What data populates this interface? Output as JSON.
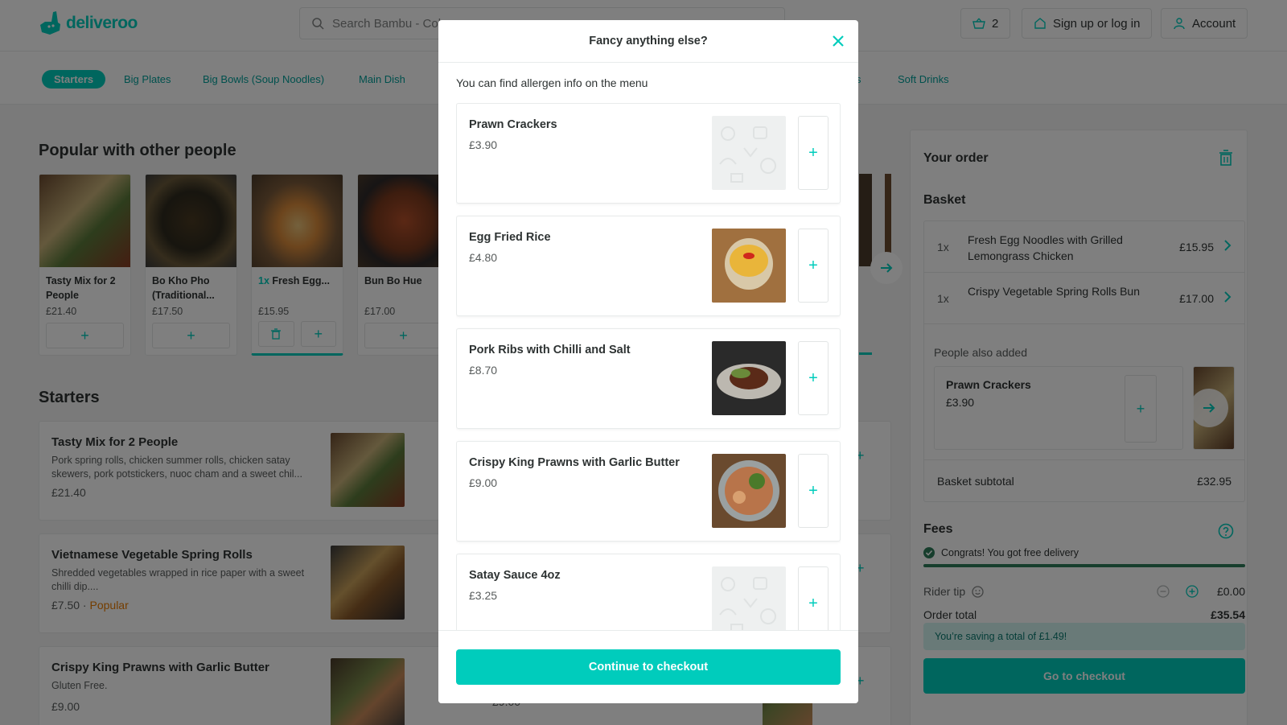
{
  "header": {
    "logo_text": "deliveroo",
    "search_placeholder": "Search Bambu - Col",
    "basket_count": "2",
    "signup_label": "Sign up or log in",
    "account_label": "Account"
  },
  "categories": [
    {
      "label": "Starters",
      "active": true
    },
    {
      "label": "Big Plates",
      "active": false
    },
    {
      "label": "Big Bowls (Soup Noodles)",
      "active": false
    },
    {
      "label": "Main Dish",
      "active": false
    },
    {
      "label": "s",
      "active": false
    },
    {
      "label": "Soft Drinks",
      "active": false
    }
  ],
  "popular": {
    "title": "Popular with other people",
    "items": [
      {
        "name": "Tasty Mix for 2 People",
        "price": "£21.40"
      },
      {
        "name": "Bo Kho Pho (Traditional...",
        "price": "£17.50"
      },
      {
        "qty": "1x",
        "name": "Fresh Egg...",
        "price": "£15.95"
      },
      {
        "name": "Bun Bo Hue",
        "price": "£17.00"
      }
    ]
  },
  "starters": {
    "title": "Starters",
    "items": [
      {
        "name": "Tasty Mix for 2 People",
        "desc": "Pork spring rolls, chicken summer rolls, chicken satay skewers, pork potstickers, nuoc cham and a sweet chil...",
        "price": "£21.40",
        "tag": ""
      },
      {
        "name": "Vietnamese Vegetable Spring Rolls",
        "desc": "Shredded vegetables wrapped in rice paper with a sweet chilli dip....",
        "price": "£7.50",
        "sep": " · ",
        "tag": "Popular"
      },
      {
        "name": "Crispy King Prawns with Garlic Butter",
        "desc": "Gluten Free.",
        "price": "£9.00",
        "tag": ""
      }
    ],
    "peek_price": "£9.00"
  },
  "order": {
    "title": "Your order",
    "basket_title": "Basket",
    "items": [
      {
        "qty": "1x",
        "name": "Fresh Egg Noodles with Grilled Lemongrass Chicken",
        "price": "£15.95"
      },
      {
        "qty": "1x",
        "name": "Crispy Vegetable Spring Rolls Bun",
        "price": "£17.00"
      }
    ],
    "also_title": "People also added",
    "also_item": {
      "name": "Prawn Crackers",
      "price": "£3.90"
    },
    "subtotal_label": "Basket subtotal",
    "subtotal_value": "£32.95",
    "fees_title": "Fees",
    "congrats": "Congrats! You got free delivery",
    "free_delivery_progress": 1.0,
    "tip_label": "Rider tip",
    "tip_value": "£0.00",
    "total_label": "Order total",
    "total_value": "£35.54",
    "saving": "You’re saving a total of £1.49!",
    "checkout_label": "Go to checkout"
  },
  "modal": {
    "title": "Fancy anything else?",
    "subtitle": "You can find allergen info on the menu",
    "items": [
      {
        "name": "Prawn Crackers",
        "price": "£3.90",
        "image": "placeholder"
      },
      {
        "name": "Egg Fried Rice",
        "price": "£4.80",
        "image": "rice"
      },
      {
        "name": "Pork Ribs with Chilli and Salt",
        "price": "£8.70",
        "image": "ribs"
      },
      {
        "name": "Crispy King Prawns with Garlic Butter",
        "price": "£9.00",
        "image": "prawns"
      },
      {
        "name": "Satay Sauce 4oz",
        "price": "£3.25",
        "image": "placeholder"
      }
    ],
    "continue_label": "Continue to checkout"
  },
  "colors": {
    "brand": "#00ccbc",
    "text": "#2e3333",
    "popular": "#e87b00"
  }
}
